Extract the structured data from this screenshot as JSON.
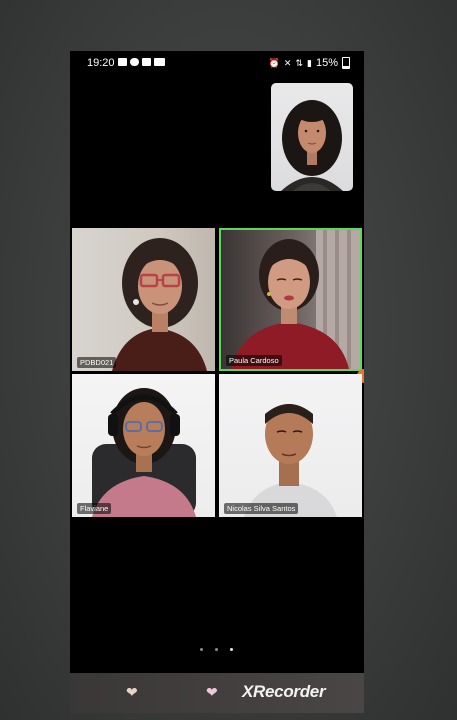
{
  "status_bar": {
    "time": "19:20",
    "battery_text": "15%",
    "left_icons": [
      "message-icon",
      "cloud-icon",
      "check-icon",
      "video-icon"
    ],
    "right_icons": [
      "alarm-icon",
      "mute-icon",
      "data-icon",
      "signal-icon"
    ]
  },
  "participants": [
    {
      "name": "PDBD021",
      "active_speaker": false
    },
    {
      "name": "Paula Cardoso",
      "active_speaker": true
    },
    {
      "name": "Flaviane",
      "active_speaker": false
    },
    {
      "name": "Nicolas Silva Santos",
      "active_speaker": false
    }
  ],
  "pagination": {
    "pages": 3,
    "active_page": 3
  },
  "bottom_bar": {
    "brand": "XRecorder",
    "icons": [
      "heart-icon",
      "heart-icon"
    ]
  },
  "colors": {
    "active_speaker_border": "#5fd85a",
    "background": "#000000",
    "label_background": "rgba(0,0,0,0.55)"
  }
}
